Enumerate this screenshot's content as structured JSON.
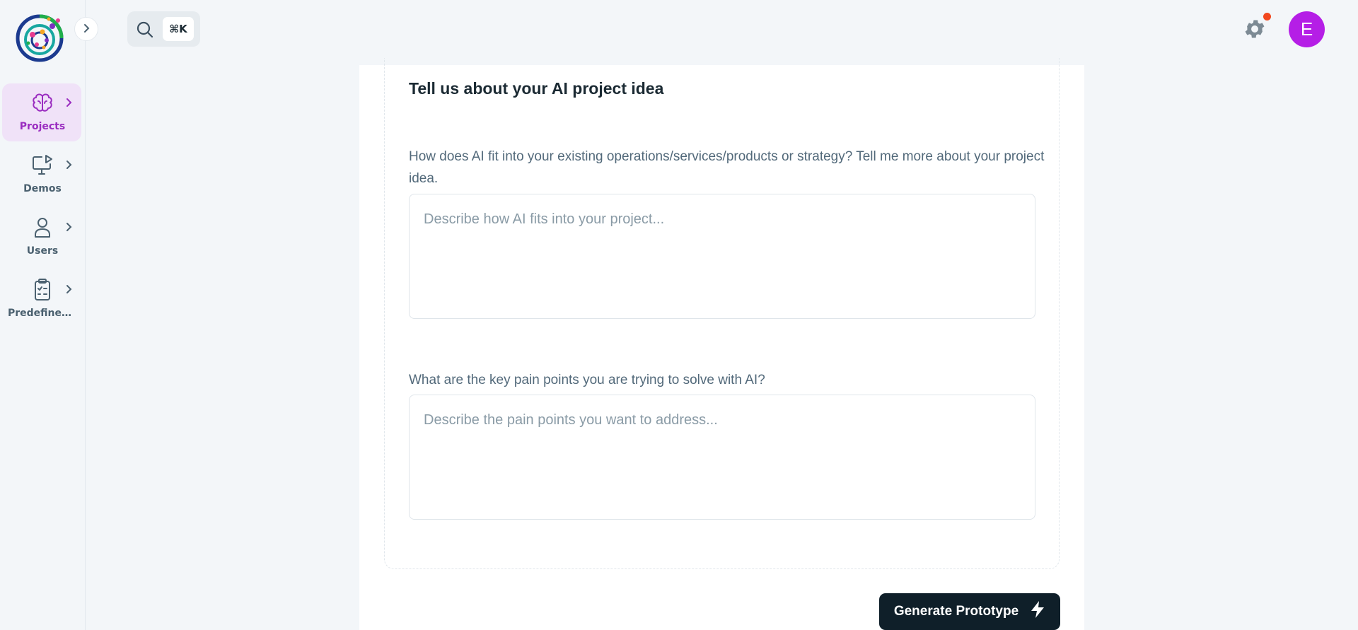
{
  "sidebar": {
    "items": [
      {
        "label": "Projects",
        "icon": "brain-icon",
        "active": true
      },
      {
        "label": "Demos",
        "icon": "monitor-play-icon",
        "active": false
      },
      {
        "label": "Users",
        "icon": "user-icon",
        "active": false
      },
      {
        "label": "Predefined...",
        "icon": "clipboard-list-icon",
        "active": false
      }
    ]
  },
  "topbar": {
    "search_shortcut": "⌘K",
    "avatar_initial": "E"
  },
  "form": {
    "title": "Tell us about your AI project idea",
    "q1_label": "How does AI fit into your existing operations/services/products or strategy? Tell me more about your project idea.",
    "q1_placeholder": "Describe how AI fits into your project...",
    "q2_label": "What are the key pain points you are trying to solve with AI?",
    "q2_placeholder": "Describe the pain points you want to address...",
    "submit_label": "Generate Prototype"
  },
  "colors": {
    "accent": "#9a2cc0",
    "avatar": "#b51ee6",
    "notification": "#f2481f",
    "button": "#0f1f29"
  }
}
